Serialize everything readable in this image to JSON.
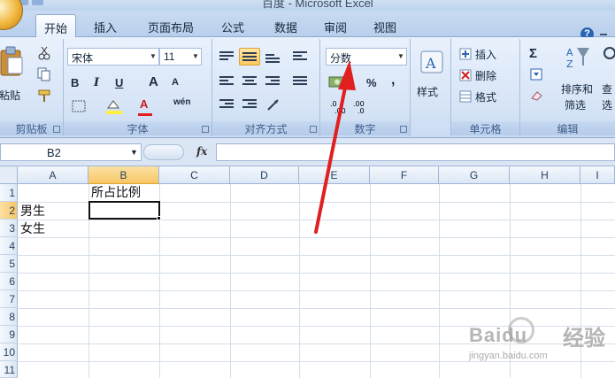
{
  "window": {
    "title": "百度 - Microsoft Excel"
  },
  "tabs": [
    {
      "label": "开始",
      "active": true
    },
    {
      "label": "插入",
      "active": false
    },
    {
      "label": "页面布局",
      "active": false
    },
    {
      "label": "公式",
      "active": false
    },
    {
      "label": "数据",
      "active": false
    },
    {
      "label": "审阅",
      "active": false
    },
    {
      "label": "视图",
      "active": false
    }
  ],
  "ribbon": {
    "clipboard": {
      "group_label": "剪贴板",
      "paste_label": "粘贴"
    },
    "font": {
      "group_label": "字体",
      "font_name": "宋体",
      "font_size": "11",
      "bold": "B",
      "italic": "I",
      "underline": "U",
      "grow": "A",
      "shrink": "A",
      "font_color_letter": "A",
      "phonetic": "wén"
    },
    "alignment": {
      "group_label": "对齐方式"
    },
    "number": {
      "group_label": "数字",
      "format_value": "分数",
      "percent": "%",
      "comma": ","
    },
    "styles": {
      "label": "样式"
    },
    "cells": {
      "group_label": "单元格",
      "insert": "插入",
      "delete": "删除",
      "format": "格式"
    },
    "editing": {
      "group_label": "编辑",
      "sort_filter_1": "排序和",
      "sort_filter_2": "筛选",
      "find_1": "查",
      "find_2": "选",
      "sum": "Σ"
    }
  },
  "formula_bar": {
    "name_box": "B2",
    "fx": "fx",
    "formula": ""
  },
  "grid": {
    "columns": [
      "A",
      "B",
      "C",
      "D",
      "E",
      "F",
      "G",
      "H",
      "I"
    ],
    "rows": [
      "1",
      "2",
      "3",
      "4",
      "5",
      "6",
      "7",
      "8",
      "9",
      "10",
      "11"
    ],
    "selected_column": "B",
    "selected_row": "2",
    "cells": {
      "B1": "所占比例",
      "A2": "男生",
      "A3": "女生"
    }
  },
  "watermark": {
    "brand": "Baidu",
    "brand_cn": "经验",
    "url": "jingyan.baidu.com"
  },
  "colors": {
    "annotation_arrow": "#e02020",
    "selection_header": "#f7c766",
    "ribbon_bg": "#d9e6f7"
  }
}
